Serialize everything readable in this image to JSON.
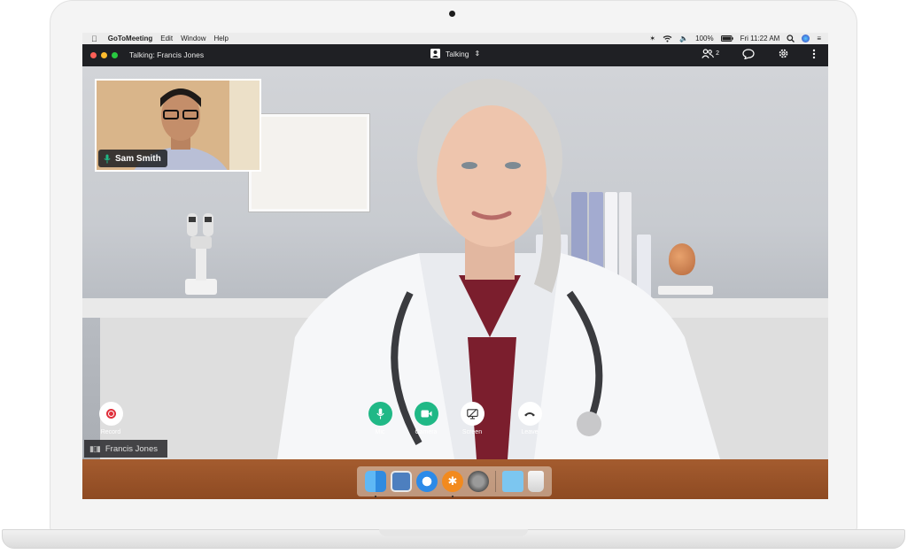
{
  "menubar": {
    "app_name": "GoToMeeting",
    "items": [
      "Edit",
      "Window",
      "Help"
    ],
    "battery": "100%",
    "clock": "Fri 11:22 AM"
  },
  "titlebar": {
    "talking_label": "Talking: Francis Jones",
    "status_label": "Talking",
    "participant_count": "2"
  },
  "thumbnail": {
    "name": "Sam Smith"
  },
  "controls": {
    "record": "Record",
    "mic": "Mic",
    "camera": "Camera",
    "screen": "Screen",
    "leave": "Leave"
  },
  "speaker_tag": "Francis Jones",
  "colors": {
    "green": "#20b886",
    "record_red": "#e0303c",
    "titlebar": "#1f2024"
  },
  "dock": {
    "icons": [
      "finder-icon",
      "preview-icon",
      "safari-icon",
      "gotomeeting-icon",
      "system-preferences-icon",
      "folder-icon",
      "trash-icon"
    ]
  }
}
